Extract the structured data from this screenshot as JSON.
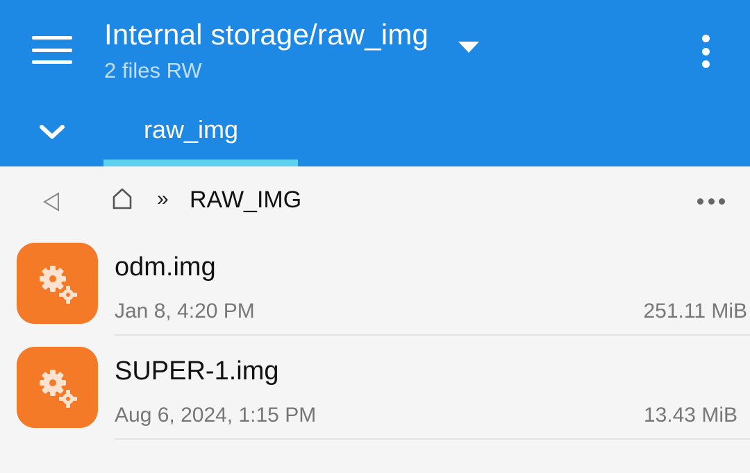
{
  "appbar": {
    "background": "#1e88e5",
    "menu_icon": "hamburger-menu-icon",
    "title": "Internal storage/raw_img",
    "title_dropdown_icon": "caret-down-icon",
    "subtitle": "2 files RW",
    "overflow_icon": "vertical-dots-icon",
    "collapse_icon": "chevron-down-icon",
    "tabs": [
      {
        "label": "raw_img",
        "selected": true
      }
    ],
    "tab_indicator_color": "#5ed0f0"
  },
  "pathbar": {
    "back_icon": "back-triangle-icon",
    "home_icon": "home-icon",
    "separator": "»",
    "current": "RAW_IMG",
    "more_icon": "horizontal-dots-icon"
  },
  "files": [
    {
      "name": "odm.img",
      "date": "Jan 8, 4:20 PM",
      "size": "251.11 MiB",
      "icon": "gears-icon",
      "icon_color": "#f47a28"
    },
    {
      "name": "SUPER-1.img",
      "date": "Aug 6, 2024, 1:15 PM",
      "size": "13.43 MiB",
      "icon": "gears-icon",
      "icon_color": "#f47a28"
    }
  ]
}
